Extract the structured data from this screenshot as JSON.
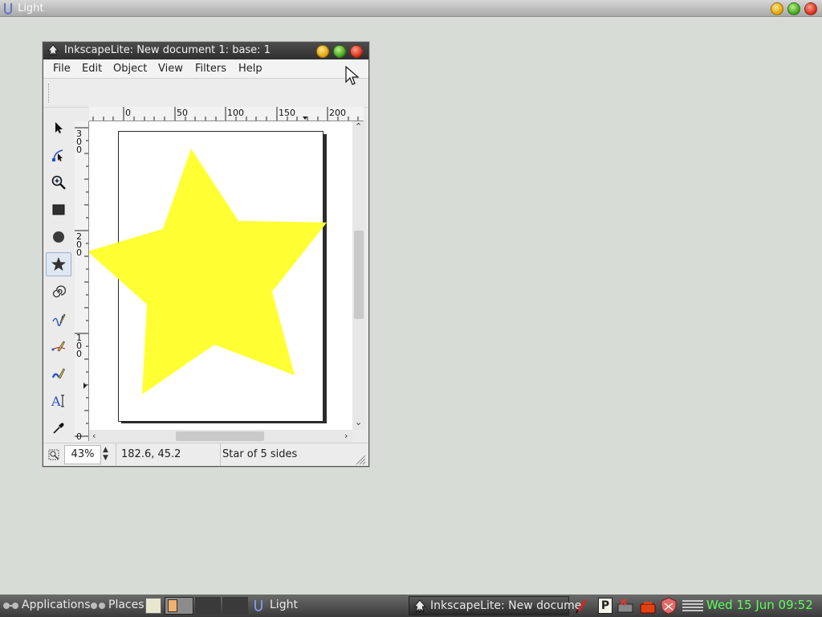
{
  "topbar": {
    "title": "Light"
  },
  "window": {
    "title": "InkscapeLite: New document 1: base: 1",
    "menus": [
      "File",
      "Edit",
      "Object",
      "View",
      "Filters",
      "Help"
    ]
  },
  "ruler_h_labels": [
    "0",
    "50",
    "100",
    "150",
    "200"
  ],
  "ruler_v_labels": [
    "3",
    "0",
    "0",
    "2",
    "0",
    "0",
    "1",
    "0",
    "0",
    "0"
  ],
  "statusbar": {
    "zoom": "43%",
    "coords": "182.6,   45.2",
    "message": "Star of 5 sides"
  },
  "colors": {
    "star_fill": "#ffff33",
    "active_tool": "star-tool"
  },
  "taskbar": {
    "applications": "Applications",
    "places": "Places",
    "task_light": "Light",
    "task_inkscape": "InkscapeLite: New docume",
    "clock": "Wed 15 Jun 09:52"
  }
}
